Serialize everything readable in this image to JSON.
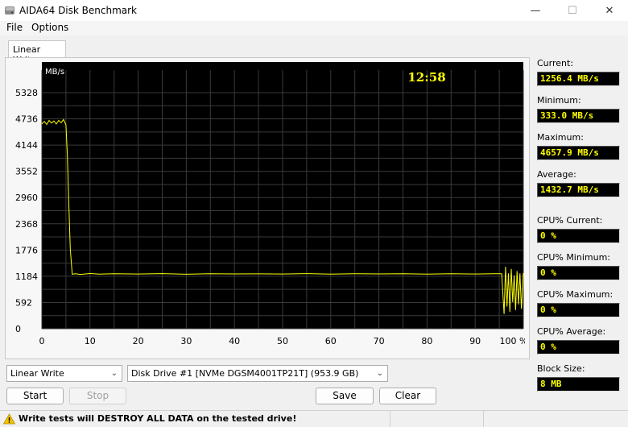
{
  "window": {
    "title": "AIDA64 Disk Benchmark"
  },
  "menu": [
    "File",
    "Options"
  ],
  "tab": {
    "label": "Linear Write"
  },
  "chart_data": {
    "type": "line",
    "title": "",
    "timer": "12:58",
    "ylabel": "MB/s",
    "xlabel": "",
    "y_ticks": [
      0,
      592,
      1184,
      1776,
      2368,
      2960,
      3552,
      4144,
      4736,
      5328
    ],
    "x_ticks": [
      "0",
      "10",
      "20",
      "30",
      "40",
      "50",
      "60",
      "70",
      "80",
      "90",
      "100 %"
    ],
    "xlim": [
      0,
      100
    ],
    "ylim": [
      0,
      5600
    ],
    "grid": true,
    "series": [
      {
        "color": "#ffff00",
        "x": [
          0,
          0.5,
          1,
          1.5,
          2,
          2.5,
          3,
          3.5,
          4,
          4.5,
          5,
          5.3,
          5.6,
          5.9,
          6.3,
          7,
          8,
          10,
          12,
          15,
          20,
          25,
          30,
          35,
          40,
          45,
          50,
          55,
          60,
          65,
          70,
          75,
          80,
          85,
          90,
          94,
          95.5,
          96,
          96.3,
          96.6,
          96.9,
          97.2,
          97.5,
          97.8,
          98.1,
          98.4,
          98.7,
          99,
          99.3,
          99.6,
          100
        ],
        "y": [
          4620,
          4680,
          4610,
          4700,
          4640,
          4690,
          4620,
          4700,
          4650,
          4720,
          4600,
          3900,
          2800,
          1800,
          1230,
          1240,
          1225,
          1245,
          1232,
          1240,
          1235,
          1244,
          1230,
          1242,
          1236,
          1238,
          1235,
          1243,
          1232,
          1240,
          1236,
          1242,
          1233,
          1240,
          1235,
          1240,
          1240,
          333,
          1400,
          500,
          1250,
          380,
          1350,
          600,
          1200,
          420,
          1300,
          550,
          1250,
          450,
          1256
        ]
      }
    ]
  },
  "stats": [
    {
      "label": "Current:",
      "value": "1256.4 MB/s"
    },
    {
      "label": "Minimum:",
      "value": "333.0 MB/s"
    },
    {
      "label": "Maximum:",
      "value": "4657.9 MB/s"
    },
    {
      "label": "Average:",
      "value": "1432.7 MB/s"
    },
    {
      "label": "CPU% Current:",
      "value": "0 %"
    },
    {
      "label": "CPU% Minimum:",
      "value": "0 %"
    },
    {
      "label": "CPU% Maximum:",
      "value": "0 %"
    },
    {
      "label": "CPU% Average:",
      "value": "0 %"
    },
    {
      "label": "Block Size:",
      "value": "8 MB"
    }
  ],
  "controls": {
    "test_select": "Linear Write",
    "drive_select": "Disk Drive #1  [NVMe    DGSM4001TP21T]  (953.9 GB)",
    "start": "Start",
    "stop": "Stop",
    "save": "Save",
    "clear": "Clear"
  },
  "status": {
    "text": "Write tests will DESTROY ALL DATA on the tested drive!"
  },
  "colors": {
    "plot_bg": "#000000",
    "grid": "#3a3a3a",
    "line": "#ffff00",
    "timer": "#ffff00",
    "value_text": "#ffff00"
  }
}
